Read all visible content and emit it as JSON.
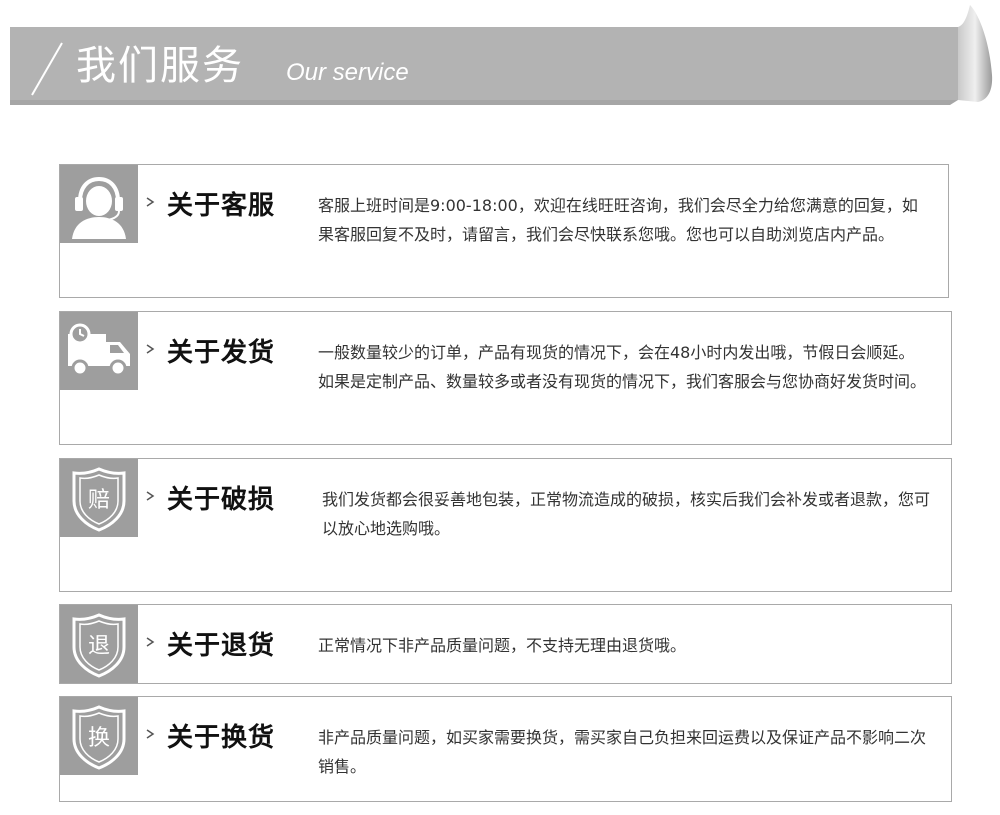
{
  "header": {
    "title": "我们服务",
    "subtitle": "Our service"
  },
  "colors": {
    "ribbon": "#b3b3b3",
    "icon_bg": "#9e9e9e",
    "border": "#a9a9a9"
  },
  "cards": [
    {
      "icon": "customer-service-headset-icon",
      "title": "关于客服",
      "body": "客服上班时间是9:00-18:00，欢迎在线旺旺咨询，我们会尽全力给您满意的回复，如果客服回复不及时，请留言，我们会尽快联系您哦。您也可以自助浏览店内产品。"
    },
    {
      "icon": "delivery-truck-clock-icon",
      "title": "关于发货",
      "body": "一般数量较少的订单，产品有现货的情况下，会在48小时内发出哦，节假日会顺延。如果是定制产品、数量较多或者没有现货的情况下，我们客服会与您协商好发货时间。"
    },
    {
      "icon": "shield-compensation-icon",
      "icon_char": "赔",
      "title": "关于破损",
      "body": "我们发货都会很妥善地包装，正常物流造成的破损，核实后我们会补发或者退款，您可以放心地选购哦。"
    },
    {
      "icon": "shield-return-icon",
      "icon_char": "退",
      "title": "关于退货",
      "body": "正常情况下非产品质量问题，不支持无理由退货哦。"
    },
    {
      "icon": "shield-exchange-icon",
      "icon_char": "换",
      "title": "关于换货",
      "body": "非产品质量问题，如买家需要换货，需买家自己负担来回运费以及保证产品不影响二次销售。"
    }
  ]
}
